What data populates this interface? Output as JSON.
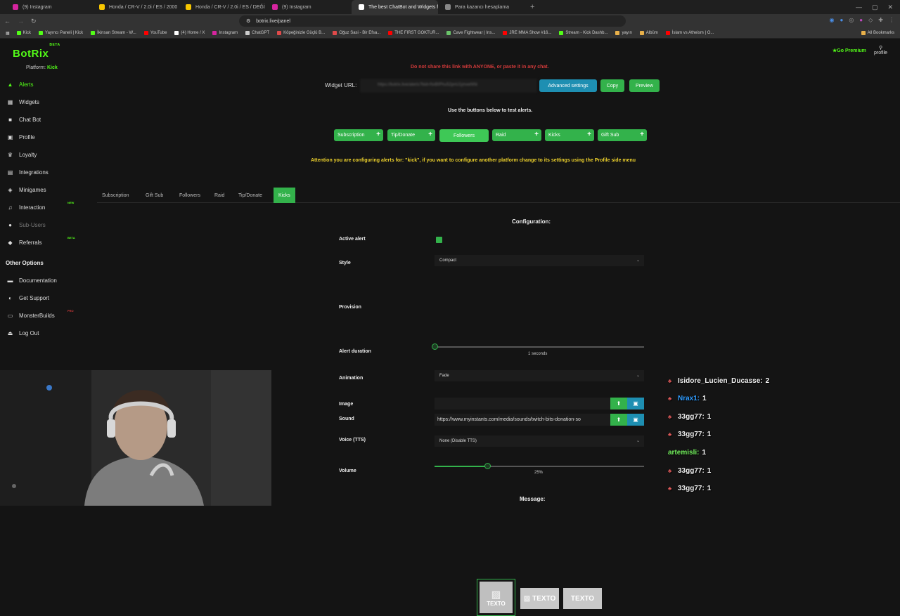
{
  "browser": {
    "tabs": [
      {
        "title": "(9) Instagram",
        "color": "#d6249f"
      },
      {
        "title": "Honda / CR-V / 2.0i / ES / 2000 mo",
        "color": "#f7c600"
      },
      {
        "title": "Honda / CR-V / 2.0i / ES / DEĞİŞEN",
        "color": "#f7c600"
      },
      {
        "title": "(9) Instagram",
        "color": "#d6249f"
      },
      {
        "title": "The best ChatBot and Widgets f",
        "color": "#ffffff",
        "active": true
      },
      {
        "title": "Para kazancı hesaplama",
        "color": "#888888"
      }
    ],
    "url": "botrix.live/panel",
    "bookmarks": [
      {
        "label": "Kick",
        "color": "#53fc18"
      },
      {
        "label": "Yayıncı Paneli | Kick",
        "color": "#53fc18"
      },
      {
        "label": "İkinsan Stream - W...",
        "color": "#53fc18"
      },
      {
        "label": "YouTube",
        "color": "#ff0000"
      },
      {
        "label": "(4) Home / X",
        "color": "#ffffff"
      },
      {
        "label": "Instagram",
        "color": "#d6249f"
      },
      {
        "label": "ChatGPT",
        "color": "#cccccc"
      },
      {
        "label": "Köpeğinizle Güçlü B...",
        "color": "#e04a4a"
      },
      {
        "label": "Oğuz Sasi - Bir Efsa...",
        "color": "#e04a4a"
      },
      {
        "label": "THE FIRST GOKTUR...",
        "color": "#ff0000"
      },
      {
        "label": "Cave Fightwear | Ins...",
        "color": "#6ac46a"
      },
      {
        "label": "JRE MMA Show #16...",
        "color": "#ff0000"
      },
      {
        "label": "Stream - Kick Dashb...",
        "color": "#53fc18"
      },
      {
        "label": "yayın",
        "color": "#e8b04a"
      },
      {
        "label": "Albüm",
        "color": "#e8b04a"
      },
      {
        "label": "İslam vs Atheism | O...",
        "color": "#ff0000"
      }
    ],
    "all_bookmarks": "All Bookmarks"
  },
  "header": {
    "logo": "BotRix",
    "logo_badge": "BETA",
    "go_premium": "Go Premium",
    "profile": "profile"
  },
  "sidebar": {
    "platform_label": "Platform:",
    "platform_value": "Kick",
    "items": [
      {
        "label": "Alerts",
        "icon": "bell-icon",
        "glyph": "▲",
        "active": true
      },
      {
        "label": "Widgets",
        "icon": "grid-icon",
        "glyph": "▦"
      },
      {
        "label": "Chat Bot",
        "icon": "chat-icon",
        "glyph": "■"
      },
      {
        "label": "Profile",
        "icon": "profile-icon",
        "glyph": "▣"
      },
      {
        "label": "Loyalty",
        "icon": "trophy-icon",
        "glyph": "♛"
      },
      {
        "label": "Integrations",
        "icon": "integrations-icon",
        "glyph": "▤"
      },
      {
        "label": "Minigames",
        "icon": "gamepad-icon",
        "glyph": "◈"
      },
      {
        "label": "Interaction",
        "icon": "music-icon",
        "glyph": "♫",
        "badge": "NEW"
      },
      {
        "label": "Sub-Users",
        "icon": "users-icon",
        "glyph": "●",
        "disabled": true
      },
      {
        "label": "Referrals",
        "icon": "referrals-icon",
        "glyph": "◆",
        "badge": "BETA"
      }
    ],
    "other_title": "Other Options",
    "other_items": [
      {
        "label": "Documentation",
        "icon": "book-icon",
        "glyph": "▬"
      },
      {
        "label": "Get Support",
        "icon": "support-icon",
        "glyph": "◐"
      },
      {
        "label": "MonsterBuilds",
        "icon": "monitor-icon",
        "glyph": "▭",
        "badge": "PRO"
      },
      {
        "label": "Log Out",
        "icon": "logout-icon",
        "glyph": "⏏"
      }
    ]
  },
  "main": {
    "warning": "Do not share this link with ANYONE, or paste it in any chat.",
    "widget_url_label": "Widget URL:",
    "widget_url_value": "https://botrix.live/alerts?bid=NxBIPhu52pnU1jmxeNNi",
    "advanced_settings": "Advanced settings",
    "copy": "Copy",
    "preview": "Preview",
    "test_title": "Use the buttons below to test alerts.",
    "test_buttons": [
      "Subscription",
      "Tip/Donate",
      "Followers",
      "Raid",
      "Kicks",
      "Gift Sub"
    ],
    "attention": "Attention you are configuring alerts for: \"kick\", if you want to configure another platform change to its settings using the Profile side menu",
    "tabs": [
      "Subscription",
      "Gift Sub",
      "Followers",
      "Raid",
      "Tip/Donate",
      "Kicks"
    ],
    "active_tab": "Kicks",
    "config_title": "Configuration:",
    "fields": {
      "active_alert": "Active alert",
      "style": "Style",
      "style_value": "Compact",
      "provision": "Provision",
      "provision_text": "TEXTO",
      "alert_duration": "Alert duration",
      "alert_duration_value": "1 seconds",
      "alert_duration_fraction": 0.0,
      "animation": "Animation",
      "animation_value": "Fade",
      "image": "Image",
      "image_value": "",
      "sound": "Sound",
      "sound_value": "https://www.myinstants.com/media/sounds/twitch-bits-donation-so",
      "voice": "Voice (TTS)",
      "voice_value": "None (Disable TTS)",
      "volume": "Volume",
      "volume_value": "25%",
      "volume_fraction": 0.25,
      "message": "Message:"
    }
  },
  "leaderboard": [
    {
      "name": "Isidore_Lucien_Ducasse:",
      "count": "2",
      "icon": true,
      "style": "white"
    },
    {
      "name": "Nrax1:",
      "count": "1",
      "icon": true,
      "style": "blue"
    },
    {
      "name": "33gg77:",
      "count": "1",
      "icon": true,
      "style": "white"
    },
    {
      "name": "33gg77:",
      "count": "1",
      "icon": true,
      "style": "white"
    },
    {
      "name": "artemisli:",
      "count": "1",
      "icon": false,
      "style": "green"
    },
    {
      "name": "33gg77:",
      "count": "1",
      "icon": true,
      "style": "white"
    },
    {
      "name": "33gg77:",
      "count": "1",
      "icon": true,
      "style": "white"
    }
  ],
  "colors": {
    "accent": "#53fc18",
    "button_green": "#33b24b",
    "button_blue": "#1e8fb2",
    "warning_red": "#d23a3a",
    "attention_yellow": "#ecd02c"
  }
}
